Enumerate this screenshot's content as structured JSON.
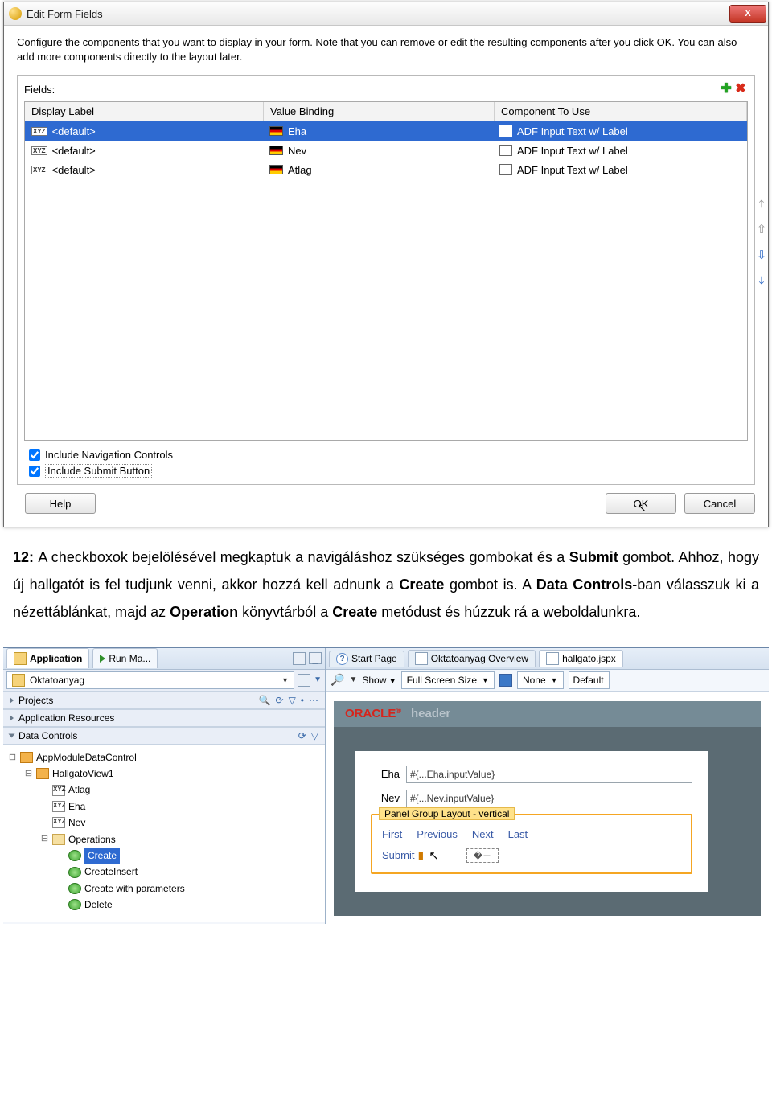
{
  "dialog": {
    "title": "Edit Form Fields",
    "description": "Configure the components that you want to display in your form.  Note that you can remove or edit the resulting components after you click OK.  You can also add more components directly to the layout later.",
    "fields_label": "Fields:",
    "columns": {
      "c1": "Display Label",
      "c2": "Value Binding",
      "c3": "Component To Use"
    },
    "rows": [
      {
        "display": "<default>",
        "binding": "Eha",
        "component": "ADF Input Text w/ Label",
        "selected": true
      },
      {
        "display": "<default>",
        "binding": "Nev",
        "component": "ADF Input Text w/ Label",
        "selected": false
      },
      {
        "display": "<default>",
        "binding": "Atlag",
        "component": "ADF Input Text w/ Label",
        "selected": false
      }
    ],
    "check1": "Include Navigation Controls",
    "check2": "Include Submit Button",
    "help": "Help",
    "ok": "OK",
    "cancel": "Cancel"
  },
  "body": {
    "prefix": "12: ",
    "text_a": "A checkboxok bejelölésével megkaptuk a navigáláshoz szükséges gombokat és a ",
    "bold1": "Submit",
    "text_b": " gombot. Ahhoz, hogy új hallgatót is fel tudjunk venni, akkor hozzá kell adnunk a ",
    "bold2": "Create",
    "text_c": " gombot is. A ",
    "bold3": "Data Controls",
    "text_d": "-ban válasszuk ki a nézettáblánkat, majd az ",
    "bold4": "Operation",
    "text_e": " könyvtárból a ",
    "bold5": "Create",
    "text_f": " metódust és húzzuk rá a weboldalunkra."
  },
  "ide": {
    "left": {
      "tab_app": "Application",
      "tab_run": "Run Ma...",
      "project_combo": "Oktatoanyag",
      "panel_projects": "Projects",
      "panel_appres": "Application Resources",
      "panel_datactrl": "Data Controls",
      "tree": {
        "root": "AppModuleDataControl",
        "view": "HallgatoView1",
        "attrs": [
          "Atlag",
          "Eha",
          "Nev"
        ],
        "ops_folder": "Operations",
        "ops": [
          "Create",
          "CreateInsert",
          "Create with parameters",
          "Delete"
        ]
      }
    },
    "right": {
      "tab_start": "Start Page",
      "tab_over": "Oktatoanyag Overview",
      "tab_jspx": "hallgato.jspx",
      "tb_show": "Show",
      "tb_full": "Full Screen Size",
      "tb_none": "None",
      "tb_default": "Default",
      "oracle": "ORACLE",
      "header": "header",
      "form": {
        "eha_label": "Eha",
        "eha_value": "#{...Eha.inputValue}",
        "nev_label": "Nev",
        "nev_value": "#{...Nev.inputValue}"
      },
      "panel_group": "Panel Group Layout - vertical",
      "nav": {
        "first": "First",
        "prev": "Previous",
        "next": "Next",
        "last": "Last"
      },
      "submit": "Submit"
    }
  }
}
